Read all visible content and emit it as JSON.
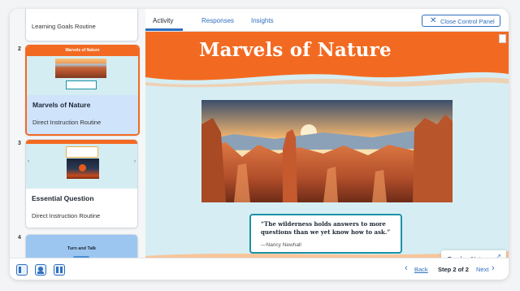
{
  "sidebar": {
    "cards": [
      {
        "number": "",
        "title": "Learning Goals Routine",
        "subtitle": ""
      },
      {
        "number": "2",
        "title": "Marvels of Nature",
        "subtitle": "Direct Instruction Routine",
        "thumb_title": "Marvels of Nature"
      },
      {
        "number": "3",
        "title": "Essential Question",
        "subtitle": "Direct Instruction Routine"
      },
      {
        "number": "4",
        "title": "",
        "subtitle": "",
        "thumb_title": "Turn and Talk"
      }
    ]
  },
  "tabs": [
    {
      "label": "Activity",
      "active": true
    },
    {
      "label": "Responses",
      "active": false
    },
    {
      "label": "Insights",
      "active": false
    }
  ],
  "close_panel_label": "Close Control Panel",
  "slide": {
    "title": "Marvels of Nature",
    "quote_text": "“The wilderness holds answers to more questions than we yet know how to ask.”",
    "quote_author": "—Nancy Newhall"
  },
  "teacher_notes_label": "Teacher Notes",
  "nav": {
    "back_label": "Back",
    "step_label": "Step 2 of 2",
    "next_label": "Next"
  },
  "colors": {
    "accent_blue": "#2f6fbf",
    "slide_orange": "#f26a21",
    "slide_sky": "#d6eef3",
    "quote_border": "#1b92a6",
    "selected_card": "#cfe3fb"
  }
}
